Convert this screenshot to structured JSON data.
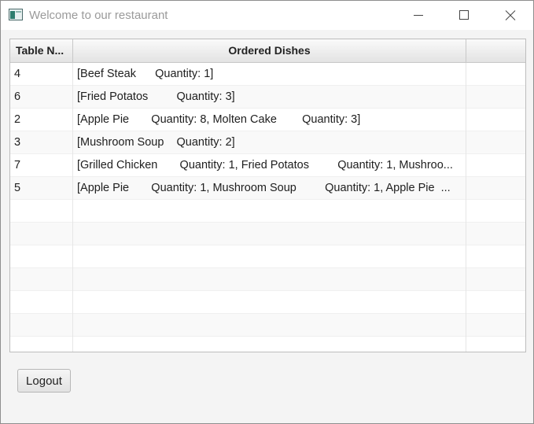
{
  "window": {
    "title": "Welcome to our restaurant"
  },
  "table": {
    "headers": [
      "Table N...",
      "Ordered Dishes",
      ""
    ],
    "rows": [
      {
        "table": "4",
        "dishes": "[Beef Steak      Quantity: 1]"
      },
      {
        "table": "6",
        "dishes": "[Fried Potatos         Quantity: 3]"
      },
      {
        "table": "2",
        "dishes": "[Apple Pie       Quantity: 8, Molten Cake        Quantity: 3]"
      },
      {
        "table": "3",
        "dishes": "[Mushroom Soup    Quantity: 2]"
      },
      {
        "table": "7",
        "dishes": "[Grilled Chicken       Quantity: 1, Fried Potatos         Quantity: 1, Mushroo..."
      },
      {
        "table": "5",
        "dishes": "[Apple Pie       Quantity: 1, Mushroom Soup         Quantity: 1, Apple Pie  ..."
      },
      {
        "table": "",
        "dishes": ""
      },
      {
        "table": "",
        "dishes": ""
      },
      {
        "table": "",
        "dishes": ""
      },
      {
        "table": "",
        "dishes": ""
      },
      {
        "table": "",
        "dishes": ""
      },
      {
        "table": "",
        "dishes": ""
      },
      {
        "table": "",
        "dishes": ""
      }
    ]
  },
  "actions": {
    "logout_label": "Logout"
  },
  "icons": {
    "app": "window-icon",
    "minimize": "minimize-icon",
    "maximize": "maximize-icon",
    "close": "close-icon"
  },
  "colors": {
    "title_text": "#9a9a9a",
    "window_bg": "#f4f4f4",
    "header_bg": "#e8e8e8"
  }
}
